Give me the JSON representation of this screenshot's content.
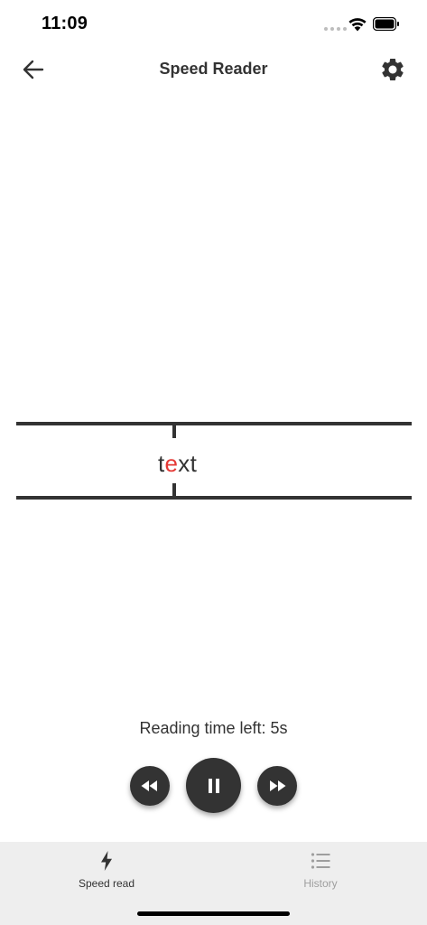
{
  "status_bar": {
    "time": "11:09",
    "icons": [
      "signal-dots-icon",
      "wifi-icon",
      "battery-icon"
    ]
  },
  "header": {
    "title": "Speed Reader",
    "back_icon": "arrow-left-icon",
    "settings_icon": "gear-icon"
  },
  "reader": {
    "word_before": "t",
    "word_focus": "e",
    "word_after": "xt",
    "focus_color": "#e53935"
  },
  "reading_time": "Reading time left: 5s",
  "controls": {
    "rewind_icon": "rewind-icon",
    "pause_icon": "pause-icon",
    "forward_icon": "fast-forward-icon"
  },
  "tabs": [
    {
      "label": "Speed read",
      "icon": "lightning-bolt-icon",
      "active": true
    },
    {
      "label": "History",
      "icon": "list-icon",
      "active": false
    }
  ],
  "colors": {
    "primary": "#333333",
    "accent": "#e53935",
    "tab_bar_background": "#eeeeee",
    "inactive_tab": "#9e9e9e"
  }
}
